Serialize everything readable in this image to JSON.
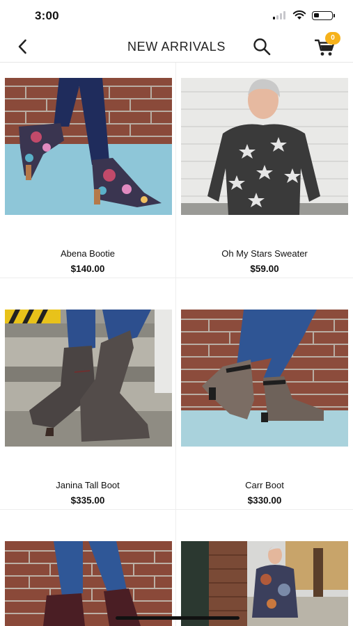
{
  "status_bar": {
    "time": "3:00",
    "battery_level": 0.3
  },
  "nav": {
    "title": "NEW ARRIVALS",
    "back_icon": "chevron-left-icon",
    "search_icon": "search-icon",
    "cart_icon": "cart-icon",
    "cart_count": "0",
    "badge_color": "#f6b21b"
  },
  "products": [
    {
      "name": "Abena Bootie",
      "price": "$140.00",
      "image": "floral-ankle-booties-photo"
    },
    {
      "name": "Oh My Stars Sweater",
      "price": "$59.00",
      "image": "star-sweater-photo"
    },
    {
      "name": "Janina Tall Boot",
      "price": "$335.00",
      "image": "tall-leather-boots-photo"
    },
    {
      "name": "Carr Boot",
      "price": "$330.00",
      "image": "buckle-ankle-boots-photo"
    },
    {
      "name": "",
      "price": "",
      "image": "burgundy-boots-photo"
    },
    {
      "name": "",
      "price": "",
      "image": "tie-dye-top-photo"
    }
  ]
}
